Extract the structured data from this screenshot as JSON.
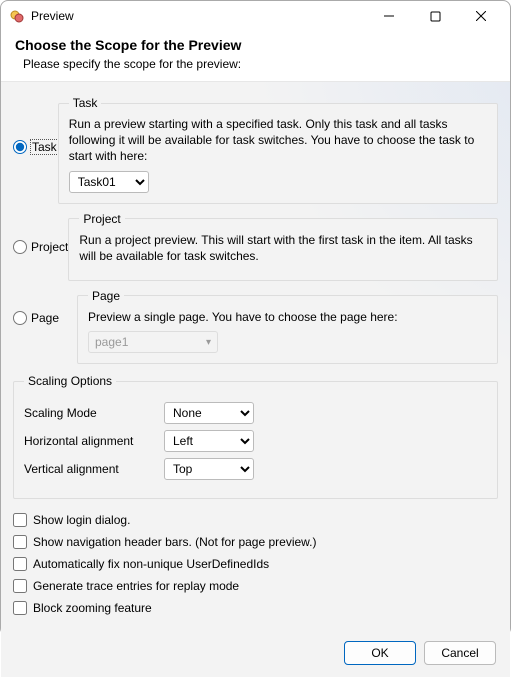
{
  "window": {
    "title": "Preview"
  },
  "header": {
    "title": "Choose the Scope for the Preview",
    "subtitle": "Please specify the scope for the preview:"
  },
  "scope": {
    "task": {
      "radio_label": "Task",
      "legend": "Task",
      "desc": "Run a preview starting with a specified task. Only this task and all tasks following it will be available for task switches. You have to choose the task to start with here:",
      "selected_value": "Task01",
      "checked": true
    },
    "project": {
      "radio_label": "Project",
      "legend": "Project",
      "desc": "Run a project preview. This will start with the first task in the item. All tasks will be available for task switches.",
      "checked": false
    },
    "page": {
      "radio_label": "Page",
      "legend": "Page",
      "desc": "Preview a single page. You have to choose the page here:",
      "selected_value": "page1",
      "checked": false
    }
  },
  "scaling": {
    "legend": "Scaling Options",
    "mode_label": "Scaling Mode",
    "mode_value": "None",
    "halign_label": "Horizontal alignment",
    "halign_value": "Left",
    "valign_label": "Vertical alignment",
    "valign_value": "Top"
  },
  "checks": {
    "login": {
      "label": "Show login dialog.",
      "checked": false
    },
    "nav": {
      "label": "Show navigation header bars. (Not for page preview.)",
      "checked": false
    },
    "autofix": {
      "label": "Automatically fix non-unique UserDefinedIds",
      "checked": false
    },
    "trace": {
      "label": "Generate trace entries for replay mode",
      "checked": false
    },
    "zoom": {
      "label": "Block zooming feature",
      "checked": false
    }
  },
  "footer": {
    "ok": "OK",
    "cancel": "Cancel"
  }
}
